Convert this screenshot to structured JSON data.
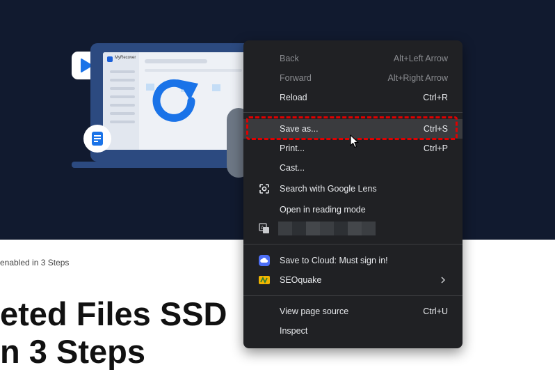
{
  "hero": {
    "app_name": "MyRecover"
  },
  "page": {
    "subtitle": "enabled in 3 Steps",
    "heading_line1": "eted Files SSD",
    "heading_line2": "n 3 Steps"
  },
  "context_menu": {
    "items": [
      {
        "label": "Back",
        "shortcut": "Alt+Left Arrow",
        "disabled": true
      },
      {
        "label": "Forward",
        "shortcut": "Alt+Right Arrow",
        "disabled": true
      },
      {
        "label": "Reload",
        "shortcut": "Ctrl+R"
      },
      {
        "label": "Save as...",
        "shortcut": "Ctrl+S",
        "highlighted": true
      },
      {
        "label": "Print...",
        "shortcut": "Ctrl+P"
      },
      {
        "label": "Cast..."
      },
      {
        "label": "Search with Google Lens",
        "icon": "google-lens-icon"
      },
      {
        "label": "Open in reading mode"
      },
      {
        "label": "",
        "icon": "translate-icon"
      },
      {
        "label": "Save to Cloud: Must sign in!",
        "icon": "cloud-extension-icon"
      },
      {
        "label": "SEOquake",
        "icon": "seoquake-icon",
        "submenu": true
      },
      {
        "label": "View page source",
        "shortcut": "Ctrl+U"
      },
      {
        "label": "Inspect"
      }
    ]
  },
  "colors": {
    "hero_bg": "#111a2f",
    "menu_bg": "#202124",
    "highlight_border": "#e00000",
    "accent_blue": "#1a73e8"
  }
}
